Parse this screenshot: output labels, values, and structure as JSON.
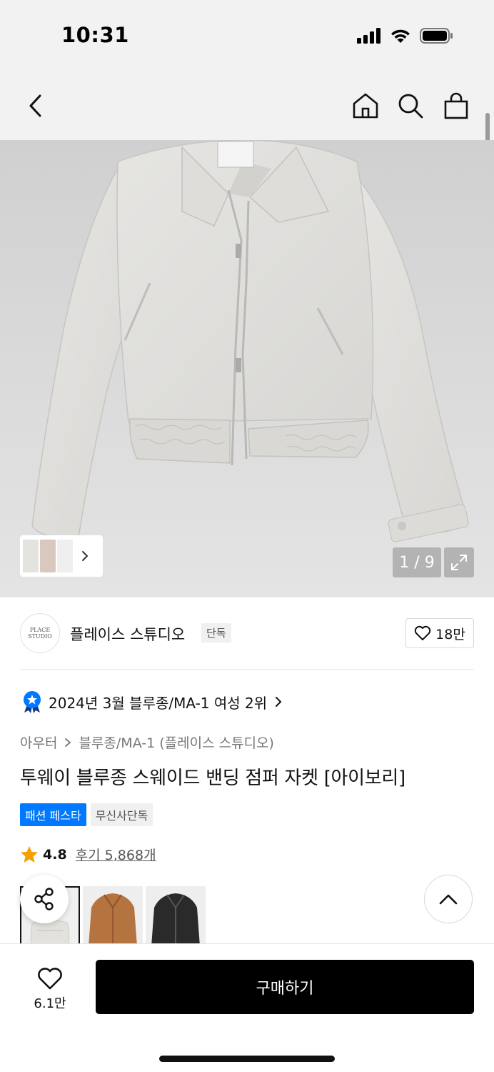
{
  "status_bar": {
    "time": "10:31"
  },
  "gallery": {
    "counter": "1 / 9"
  },
  "brand": {
    "logo_text": "PLACE STUDIO",
    "name": "플레이스 스튜디오",
    "exclusive_tag": "단독",
    "likes": "18만"
  },
  "ranking": {
    "text": "2024년 3월 블루종/MA-1 여성 2위"
  },
  "breadcrumb": {
    "category": "아우터",
    "subcategory": "블루종/MA-1 (플레이스 스튜디오)"
  },
  "product": {
    "title": "투웨이 블루종 스웨이드 밴딩 점퍼 자켓 [아이보리]",
    "badges": [
      "패션 페스타",
      "무신사단독"
    ],
    "rating": "4.8",
    "reviews": "후기 5,868개"
  },
  "bottom_bar": {
    "like_count": "6.1만",
    "buy_label": "구매하기"
  },
  "colors": {
    "accent_blue": "#0078ff",
    "star": "#f5a000",
    "buy_button": "#000000"
  }
}
